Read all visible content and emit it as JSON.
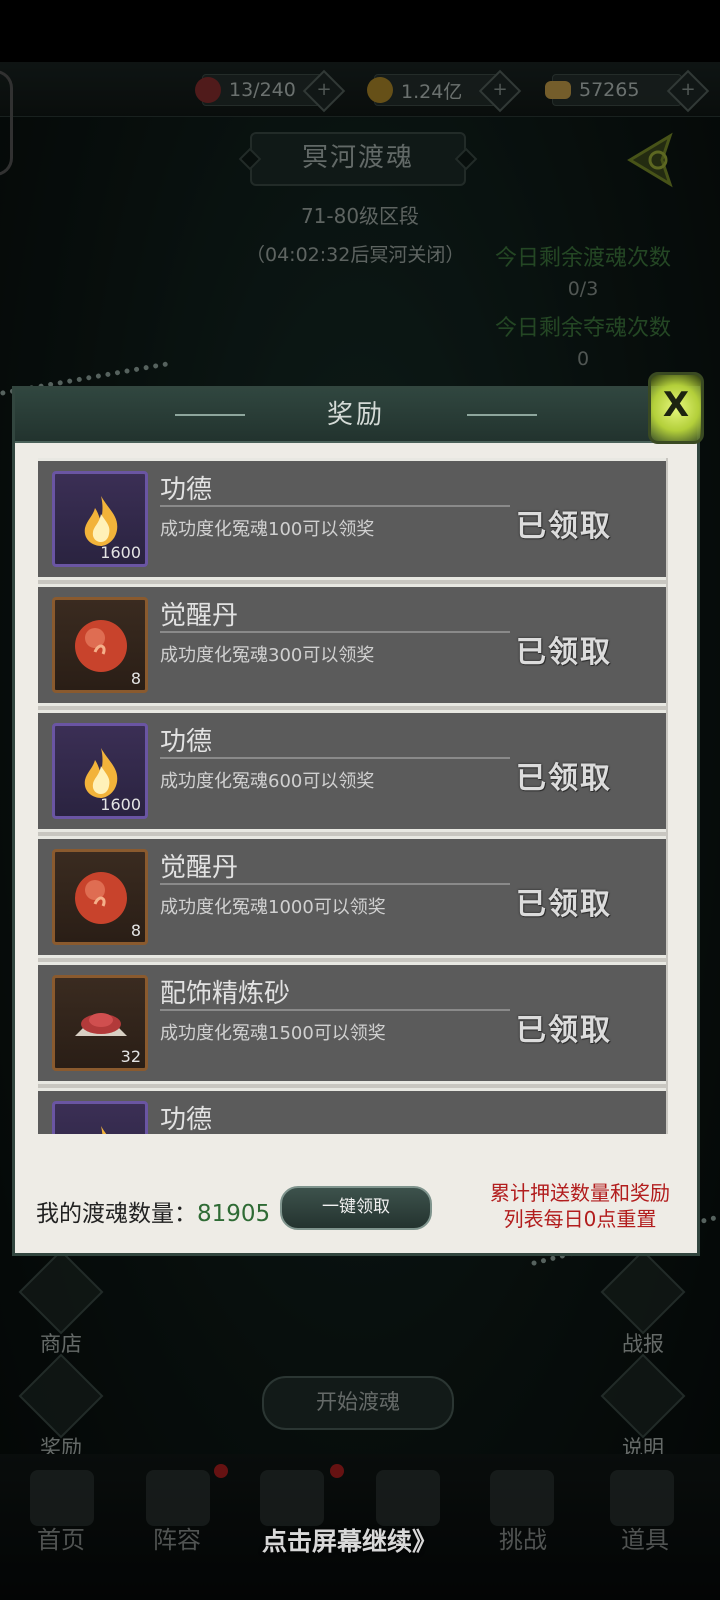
{
  "resources": [
    {
      "name": "stamina",
      "icon": "gourd-icon",
      "value": "13/240",
      "color": "#8a2f2f"
    },
    {
      "name": "coins",
      "icon": "coin-icon",
      "value": "1.24亿",
      "color": "#b08a2a"
    },
    {
      "name": "gold",
      "icon": "ingot-icon",
      "value": "57265",
      "color": "#c9a14a"
    }
  ],
  "plus_label": "+",
  "page_title": "冥河渡魂",
  "rank_range": "71-80级区段",
  "close_timer": "（04:02:32后冥河关闭）",
  "counts": {
    "ferry_label": "今日剩余渡魂次数",
    "ferry_value": "0/3",
    "steal_label": "今日剩余夺魂次数",
    "steal_value": "0"
  },
  "modal": {
    "title": "奖励",
    "close_label": "X",
    "rewards": [
      {
        "name": "功德",
        "desc": "成功度化冤魂100可以领奖",
        "qty": "1600",
        "status": "已领取",
        "icon": "flame-icon",
        "frame": "purple"
      },
      {
        "name": "觉醒丹",
        "desc": "成功度化冤魂300可以领奖",
        "qty": "8",
        "status": "已领取",
        "icon": "pill-icon",
        "frame": "orange"
      },
      {
        "name": "功德",
        "desc": "成功度化冤魂600可以领奖",
        "qty": "1600",
        "status": "已领取",
        "icon": "flame-icon",
        "frame": "purple"
      },
      {
        "name": "觉醒丹",
        "desc": "成功度化冤魂1000可以领奖",
        "qty": "8",
        "status": "已领取",
        "icon": "pill-icon",
        "frame": "orange"
      },
      {
        "name": "配饰精炼砂",
        "desc": "成功度化冤魂1500可以领奖",
        "qty": "32",
        "status": "已领取",
        "icon": "sand-icon",
        "frame": "orange"
      },
      {
        "name": "功德",
        "desc": "",
        "qty": "",
        "status": "",
        "icon": "flame-icon",
        "frame": "purple"
      }
    ],
    "my_count_label": "我的渡魂数量：",
    "my_count_value": "81905",
    "claim_all_label": "一键领取",
    "reset_note_line1": "累计押送数量和奖励",
    "reset_note_line2": "列表每日0点重置"
  },
  "side_buttons": {
    "shop": "商店",
    "reward": "奖励",
    "report": "战报",
    "help": "说明"
  },
  "start_label": "开始渡魂",
  "bottom_nav": [
    "首页",
    "阵容",
    "挑战",
    "道具"
  ],
  "continue_hint": "点击屏幕继续》"
}
